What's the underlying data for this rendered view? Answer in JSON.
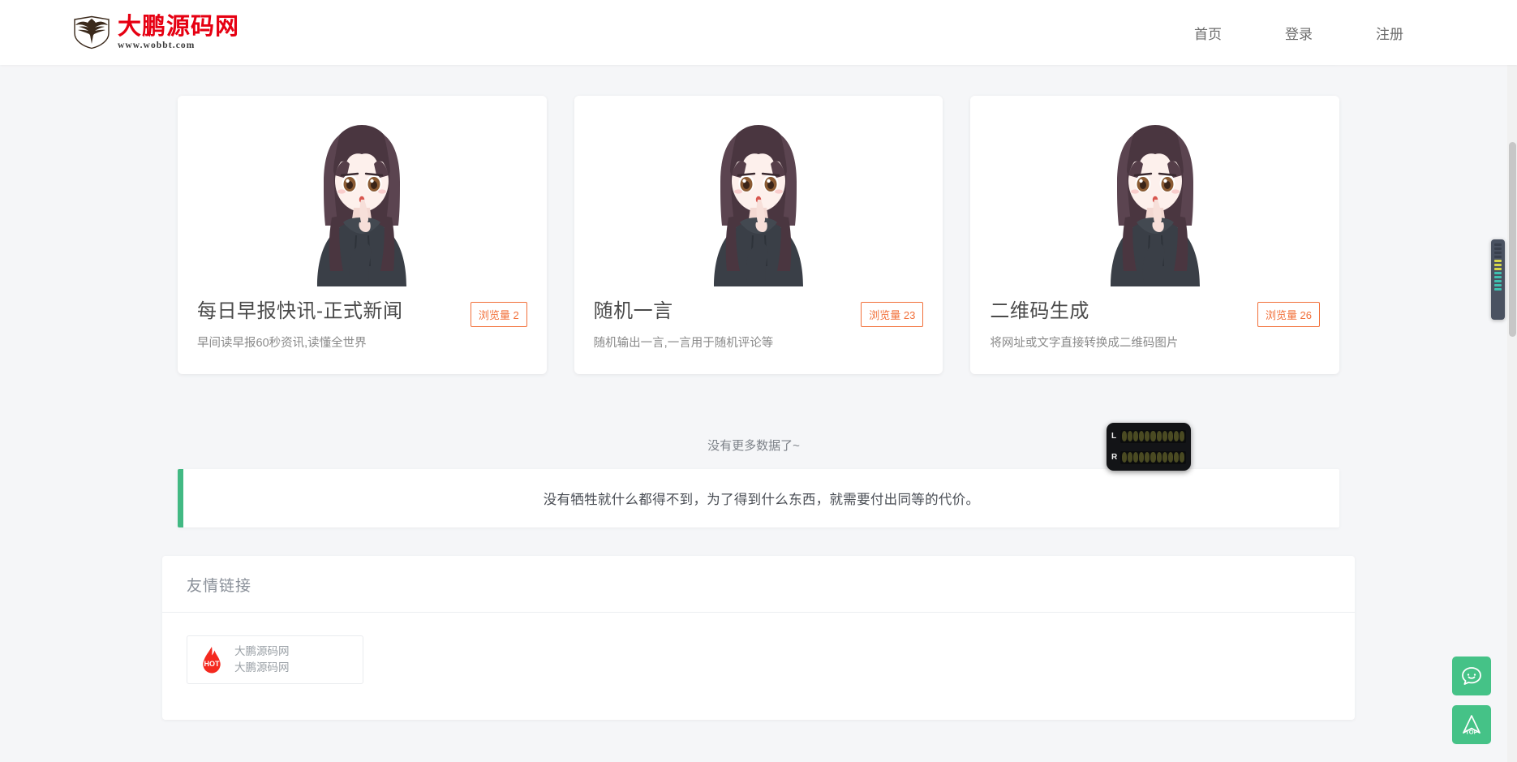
{
  "header": {
    "logo": {
      "icon": "eagle-emblem-icon",
      "brand_cn": "大鹏源码网",
      "brand_url": "www.wobbt.com",
      "brand_color": "#e60012"
    },
    "nav": [
      {
        "label": "首页",
        "name": "nav-home"
      },
      {
        "label": "登录",
        "name": "nav-login"
      },
      {
        "label": "注册",
        "name": "nav-register"
      }
    ]
  },
  "cards": [
    {
      "title": "每日早报快讯-正式新闻",
      "desc": "早间读早报60秒资讯,读懂全世界",
      "badge": "浏览量 2",
      "thumb_icon": "anime-girl-illustration"
    },
    {
      "title": "随机一言",
      "desc": "随机输出一言,一言用于随机评论等",
      "badge": "浏览量 23",
      "thumb_icon": "anime-girl-illustration"
    },
    {
      "title": "二维码生成",
      "desc": "将网址或文字直接转换成二维码图片",
      "badge": "浏览量 26",
      "thumb_icon": "anime-girl-illustration"
    }
  ],
  "list_end": {
    "text": "没有更多数据了~"
  },
  "quote": {
    "text": "没有牺牲就什么都得不到，为了得到什么东西，就需要付出同等的代价。",
    "accent_color": "#42b983"
  },
  "friend_links": {
    "title": "友情链接",
    "items": [
      {
        "icon": "hot-flame-icon",
        "icon_label": "HOT",
        "title": "大鹏源码网",
        "desc": "大鹏源码网"
      }
    ]
  },
  "side_buttons": [
    {
      "name": "feedback-smiley-button",
      "icon": "smiley-chat-icon"
    },
    {
      "name": "back-to-top-button",
      "icon": "top-arrow-icon",
      "label": "TOP"
    }
  ],
  "vu_meter": {
    "left_label": "L",
    "right_label": "R",
    "segments": 11
  },
  "theme": {
    "page_bg": "#f5f6f8",
    "card_bg": "#ffffff",
    "badge_color": "#f2703a",
    "green_accent": "#45c287"
  }
}
